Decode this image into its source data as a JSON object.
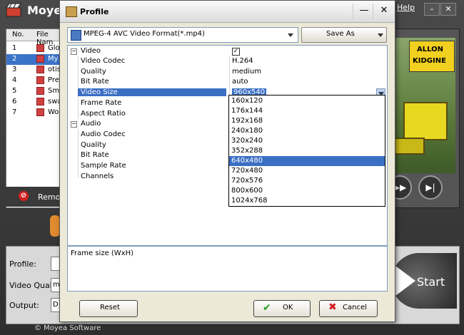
{
  "app": {
    "title": "Moyea",
    "help": "Help",
    "window_buttons": [
      "–",
      "□",
      "✕"
    ],
    "file_list": {
      "headers": [
        "No.",
        "File Nam"
      ],
      "rows": [
        {
          "no": "1",
          "name": "Glo"
        },
        {
          "no": "2",
          "name": "My",
          "selected": true
        },
        {
          "no": "3",
          "name": "otis"
        },
        {
          "no": "4",
          "name": "Pre"
        },
        {
          "no": "5",
          "name": "Sm"
        },
        {
          "no": "6",
          "name": "swa"
        },
        {
          "no": "7",
          "name": "Wo"
        }
      ],
      "remove_label": "Remov"
    },
    "preview": {
      "sign_line1": "ALLON",
      "sign_line2": "KIDGINE"
    },
    "settings": {
      "profile_label": "Profile:",
      "quality_label": "Video Quality:",
      "quality_value": "m",
      "output_label": "Output:",
      "output_value": "D:"
    },
    "start_label": "Start",
    "copyright": "© Moyea Software"
  },
  "dialog": {
    "title": "Profile",
    "minimize": "—",
    "close": "✕",
    "format": "MPEG-4 AVC Video Format(*.mp4)",
    "save_as": "Save As",
    "properties": [
      {
        "key": "Video",
        "category": true,
        "checked": "✓"
      },
      {
        "key": "Video Codec",
        "value": "H.264"
      },
      {
        "key": "Quality",
        "value": "medium"
      },
      {
        "key": "Bit Rate",
        "value": "auto"
      },
      {
        "key": "Video Size",
        "value": "960x540",
        "selected": true
      },
      {
        "key": "Frame Rate",
        "value": ""
      },
      {
        "key": "Aspect Ratio",
        "value": ""
      },
      {
        "key": "Audio",
        "category": true
      },
      {
        "key": "Audio Codec",
        "value": ""
      },
      {
        "key": "Quality",
        "value": ""
      },
      {
        "key": "Bit Rate",
        "value": ""
      },
      {
        "key": "Sample Rate",
        "value": ""
      },
      {
        "key": "Channels",
        "value": ""
      }
    ],
    "size_options": [
      "160x120",
      "176x144",
      "192x168",
      "240x180",
      "320x240",
      "352x288",
      "640x480",
      "720x480",
      "720x576",
      "800x600",
      "1024x768"
    ],
    "size_highlighted": "640x480",
    "description": "Frame size (WxH)",
    "reset": "Reset",
    "ok": "OK",
    "cancel": "Cancel"
  }
}
